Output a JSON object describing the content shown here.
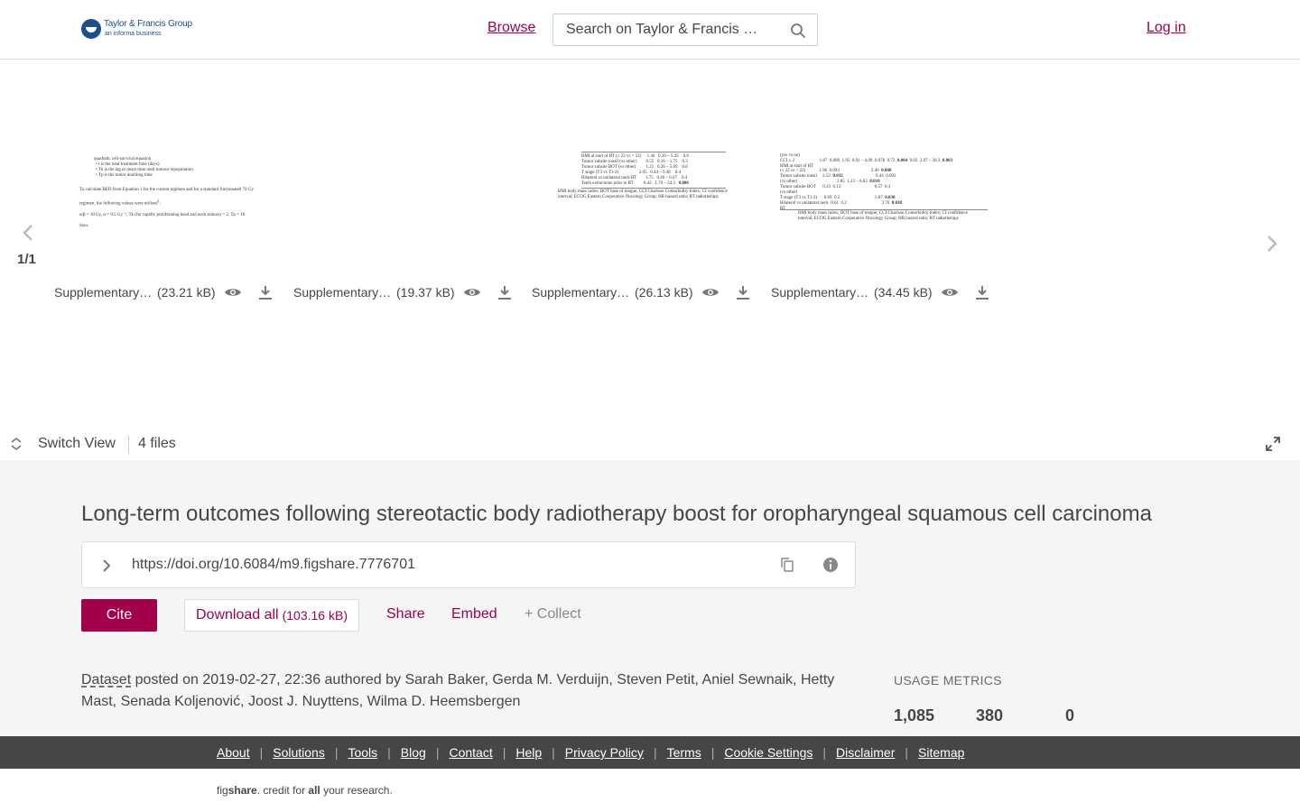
{
  "header": {
    "logo_main": "Taylor & Francis Group",
    "logo_sub": "an informa business",
    "browse": "Browse",
    "search_placeholder": "Search on Taylor & Francis …",
    "login": "Log in"
  },
  "carousel": {
    "page_count": "1/1",
    "files": [
      {
        "name": "Supplementary…",
        "size": "(23.21 kB)"
      },
      {
        "name": "Supplementary…",
        "size": "(19.37 kB)"
      },
      {
        "name": "Supplementary…",
        "size": "(26.13 kB)"
      },
      {
        "name": "Supplementary…",
        "size": "(34.45 kB)"
      }
    ],
    "switch_view": "Switch View",
    "files_count": "4 files"
  },
  "item": {
    "title": "Long-term outcomes following stereotactic body radiotherapy boost for oropharyngeal squamous cell carcinoma",
    "doi": "https://doi.org/10.6084/m9.figshare.7776701",
    "cite": "Cite",
    "download_all": "Download all",
    "download_size": "(103.16 kB)",
    "share": "Share",
    "embed": "Embed",
    "collect": "+ Collect",
    "type": "Dataset",
    "posted_text": " posted on 2019-02-27, 22:36 authored by Sarah Baker, Gerda M. Verduijn, Steven Petit, Aniel Sewnaik, Hetty Mast, Senada Koljenović, Joost J. Nuyttens, Wilma D. Heemsbergen"
  },
  "usage": {
    "title": "USAGE METRICS",
    "values": [
      "1,085",
      "380",
      "0"
    ]
  },
  "footer": {
    "links": [
      "About",
      "Solutions",
      "Tools",
      "Blog",
      "Contact",
      "Help",
      "Privacy Policy",
      "Terms",
      "Cookie Settings",
      "Disclaimer",
      "Sitemap"
    ],
    "credit_fig": "fig",
    "credit_share": "share",
    "credit_mid": ". credit for ",
    "credit_all": "all",
    "credit_end": " your research."
  },
  "colors": {
    "brand": "#a3004b",
    "footer_bg": "#464646",
    "main_bg": "#f5f5f5"
  }
}
